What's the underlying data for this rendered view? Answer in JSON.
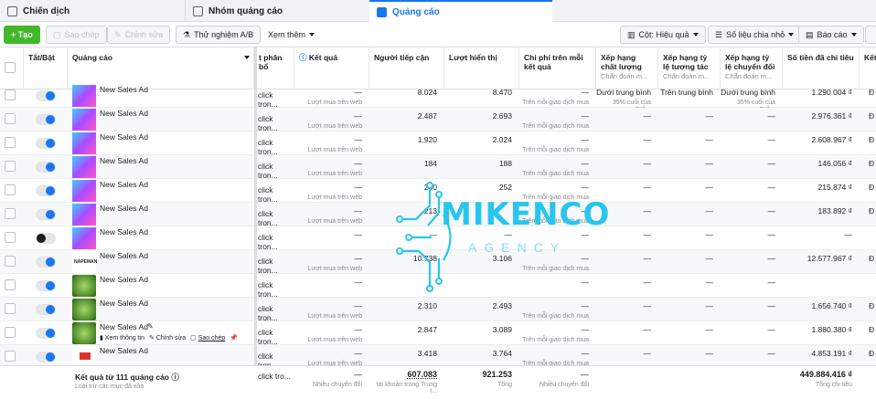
{
  "tabs": [
    {
      "label": "Chiến dịch"
    },
    {
      "label": "Nhóm quảng cáo"
    },
    {
      "label": "Quảng cáo"
    }
  ],
  "toolbar": {
    "create": "+ Tạo",
    "duplicate": "Sao chép",
    "edit": "Chỉnh sửa",
    "ab_test": "Thử nghiệm A/B",
    "view_more": "Xem thêm",
    "columns": "Cột: Hiệu quả",
    "breakdown": "Số liệu chia nhỏ",
    "reports": "Báo cáo"
  },
  "columns": {
    "toggle": "Tắt/Bật",
    "ad": "Quảng cáo",
    "delivery": "t phân bổ",
    "results": "Kết quả",
    "reach": "Người tiếp cận",
    "impressions": "Lượt hiển thị",
    "cost_per_result": "Chi phí trên mỗi kết quả",
    "quality": "Xếp hạng chất lượng",
    "quality_sub": "Chẩn đoán m...",
    "engagement": "Xếp hạng tỷ lệ tương tác",
    "engagement_sub": "Chẩn đoán m...",
    "conversion": "Xếp hạng tỷ lệ chuyển đổi",
    "conversion_sub": "Chẩn đoán m...",
    "spent": "Số tiền đã chi tiêu",
    "end": "Kết"
  },
  "rows": [
    {
      "name": "New Sales Ad",
      "on": true,
      "thumb": "grad",
      "delivery": "click tron...",
      "result": "—",
      "result_sub": "Lượt mua trên web",
      "reach": "8.024",
      "impr": "8.470",
      "cpr": "—",
      "cpr_sub": "Trên mỗi giao dịch mua",
      "quality": "Dưới trung bình",
      "quality_sub": "35% cuối của quả...",
      "eng": "Trên trung bình",
      "conv": "Dưới trung bình",
      "conv_sub": "35% cuối của quả...",
      "spent": "1.290.004 ₫",
      "end": "Đ"
    },
    {
      "name": "New Sales Ad",
      "on": true,
      "thumb": "grad",
      "delivery": "click tron...",
      "result": "—",
      "result_sub": "Lượt mua trên web",
      "reach": "2.487",
      "impr": "2.693",
      "cpr": "—",
      "cpr_sub": "Trên mỗi giao dịch mua",
      "quality": "—",
      "quality_sub": "",
      "eng": "—",
      "conv": "—",
      "conv_sub": "",
      "spent": "2.976.361 ₫",
      "end": "Đ"
    },
    {
      "name": "New Sales Ad",
      "on": true,
      "thumb": "grad",
      "delivery": "click tron...",
      "result": "—",
      "result_sub": "Lượt mua trên web",
      "reach": "1.920",
      "impr": "2.024",
      "cpr": "—",
      "cpr_sub": "Trên mỗi giao dịch mua",
      "quality": "—",
      "quality_sub": "",
      "eng": "—",
      "conv": "—",
      "conv_sub": "",
      "spent": "2.608.967 ₫",
      "end": "Đ"
    },
    {
      "name": "New Sales Ad",
      "on": true,
      "thumb": "grad",
      "delivery": "click tron...",
      "result": "—",
      "result_sub": "Lượt mua trên web",
      "reach": "184",
      "impr": "188",
      "cpr": "—",
      "cpr_sub": "Trên mỗi giao dịch mua",
      "quality": "—",
      "quality_sub": "",
      "eng": "—",
      "conv": "—",
      "conv_sub": "",
      "spent": "146.056 ₫",
      "end": "Đ"
    },
    {
      "name": "New Sales Ad",
      "on": true,
      "thumb": "grad",
      "delivery": "click tron...",
      "result": "—",
      "result_sub": "Lượt mua trên web",
      "reach": "250",
      "impr": "252",
      "cpr": "—",
      "cpr_sub": "Trên mỗi giao dịch mua",
      "quality": "—",
      "quality_sub": "",
      "eng": "—",
      "conv": "—",
      "conv_sub": "",
      "spent": "215.874 ₫",
      "end": "Đ"
    },
    {
      "name": "New Sales Ad",
      "on": true,
      "thumb": "grad",
      "delivery": "click tron...",
      "result": "—",
      "result_sub": "Lượt mua trên web",
      "reach": "213",
      "impr": "",
      "cpr": "—",
      "cpr_sub": "Trên mỗi giao dịch mua",
      "quality": "—",
      "quality_sub": "",
      "eng": "—",
      "conv": "—",
      "conv_sub": "",
      "spent": "183.892 ₫",
      "end": "Đ"
    },
    {
      "name": "New Sales Ad",
      "on": false,
      "thumb": "grad",
      "delivery": "click tron...",
      "result": "—",
      "result_sub": "",
      "reach": "—",
      "impr": "—",
      "cpr": "—",
      "cpr_sub": "",
      "quality": "—",
      "quality_sub": "",
      "eng": "—",
      "conv": "—",
      "conv_sub": "",
      "spent": "—",
      "end": ""
    },
    {
      "name": "New Sales Ad",
      "on": true,
      "thumb": "logo",
      "delivery": "click tron...",
      "result": "—",
      "result_sub": "Lượt mua trên web",
      "reach": "10.738",
      "impr": "3.106",
      "cpr": "—",
      "cpr_sub": "Trên mỗi giao dịch mua",
      "quality": "—",
      "quality_sub": "",
      "eng": "—",
      "conv": "—",
      "conv_sub": "",
      "spent": "12.577.967 ₫",
      "end": "Đ"
    },
    {
      "name": "New Sales Ad",
      "on": true,
      "thumb": "veg",
      "delivery": "click tron...",
      "result": "—",
      "result_sub": "",
      "reach": "",
      "impr": "",
      "cpr": "—",
      "cpr_sub": "",
      "quality": "—",
      "quality_sub": "",
      "eng": "—",
      "conv": "—",
      "conv_sub": "",
      "spent": "",
      "end": ""
    },
    {
      "name": "New Sales Ad",
      "on": true,
      "thumb": "veg",
      "delivery": "click tron...",
      "result": "—",
      "result_sub": "Lượt mua trên web",
      "reach": "2.310",
      "impr": "2.493",
      "cpr": "—",
      "cpr_sub": "Trên mỗi giao dịch mua",
      "quality": "—",
      "quality_sub": "",
      "eng": "—",
      "conv": "—",
      "conv_sub": "",
      "spent": "1.656.740 ₫",
      "end": "Đ"
    },
    {
      "name": "New Sales Ad",
      "on": true,
      "thumb": "veg",
      "delivery": "click tron...",
      "result": "—",
      "result_sub": "Lượt mua trên web",
      "reach": "2.847",
      "impr": "3.089",
      "cpr": "—",
      "cpr_sub": "Trên mỗi giao dịch mua",
      "quality": "—",
      "quality_sub": "",
      "eng": "—",
      "conv": "—",
      "conv_sub": "",
      "spent": "1.880.380 ₫",
      "end": "Đ",
      "hovered": true
    },
    {
      "name": "New Sales Ad",
      "on": true,
      "thumb": "red",
      "delivery": "click tron...",
      "result": "—",
      "result_sub": "Lượt mua trên web",
      "reach": "3.418",
      "impr": "3.764",
      "cpr": "—",
      "cpr_sub": "Trên mỗi giao dịch mua",
      "quality": "—",
      "quality_sub": "",
      "eng": "—",
      "conv": "—",
      "conv_sub": "",
      "spent": "4.853.191 ₫",
      "end": "Đ"
    }
  ],
  "row_actions": {
    "view": "Xem thông tin",
    "edit": "Chỉnh sửa",
    "dup": "Sao chép"
  },
  "thumb_logo_text": "NAPEMAN",
  "footer": {
    "title": "Kết quả từ 111 quảng cáo",
    "subtitle": "Loại trừ các mục đã xóa",
    "delivery": "click tro...",
    "result": "—",
    "result_sub": "Nhiều chuyển đổi",
    "reach": "607.083",
    "reach_sub": "tài khoản trong Trung t...",
    "impr": "921.253",
    "impr_sub": "Tổng",
    "cpr": "—",
    "cpr_sub": "Nhiều chuyển đổi",
    "spent": "449.884.416 ₫",
    "spent_sub": "Tổng chi tiêu"
  },
  "watermark": {
    "brand": "MIKENCO",
    "tag": "AGENCY"
  },
  "colors": {
    "accent": "#1877f2",
    "create": "#42b72a",
    "watermark": "#28c6ee"
  }
}
